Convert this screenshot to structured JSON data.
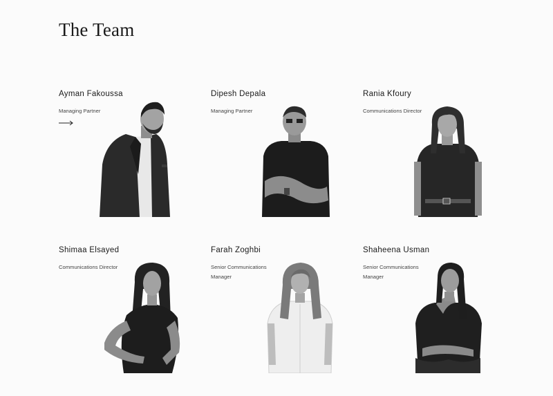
{
  "page": {
    "title": "The Team"
  },
  "team": [
    {
      "name": "Ayman Fakoussa",
      "role": "Managing Partner",
      "has_arrow": true
    },
    {
      "name": "Dipesh Depala",
      "role": "Managing Partner"
    },
    {
      "name": "Rania Kfoury",
      "role": "Communications Director"
    },
    {
      "name": "Shimaa Elsayed",
      "role": "Communications Director"
    },
    {
      "name": "Farah Zoghbi",
      "role": "Senior Communications Manager"
    },
    {
      "name": "Shaheena Usman",
      "role": "Senior Communications Manager"
    }
  ],
  "icons": {
    "arrow": "arrow-right-icon"
  },
  "colors": {
    "background": "#fbfbfb",
    "text": "#1a1a1a"
  }
}
